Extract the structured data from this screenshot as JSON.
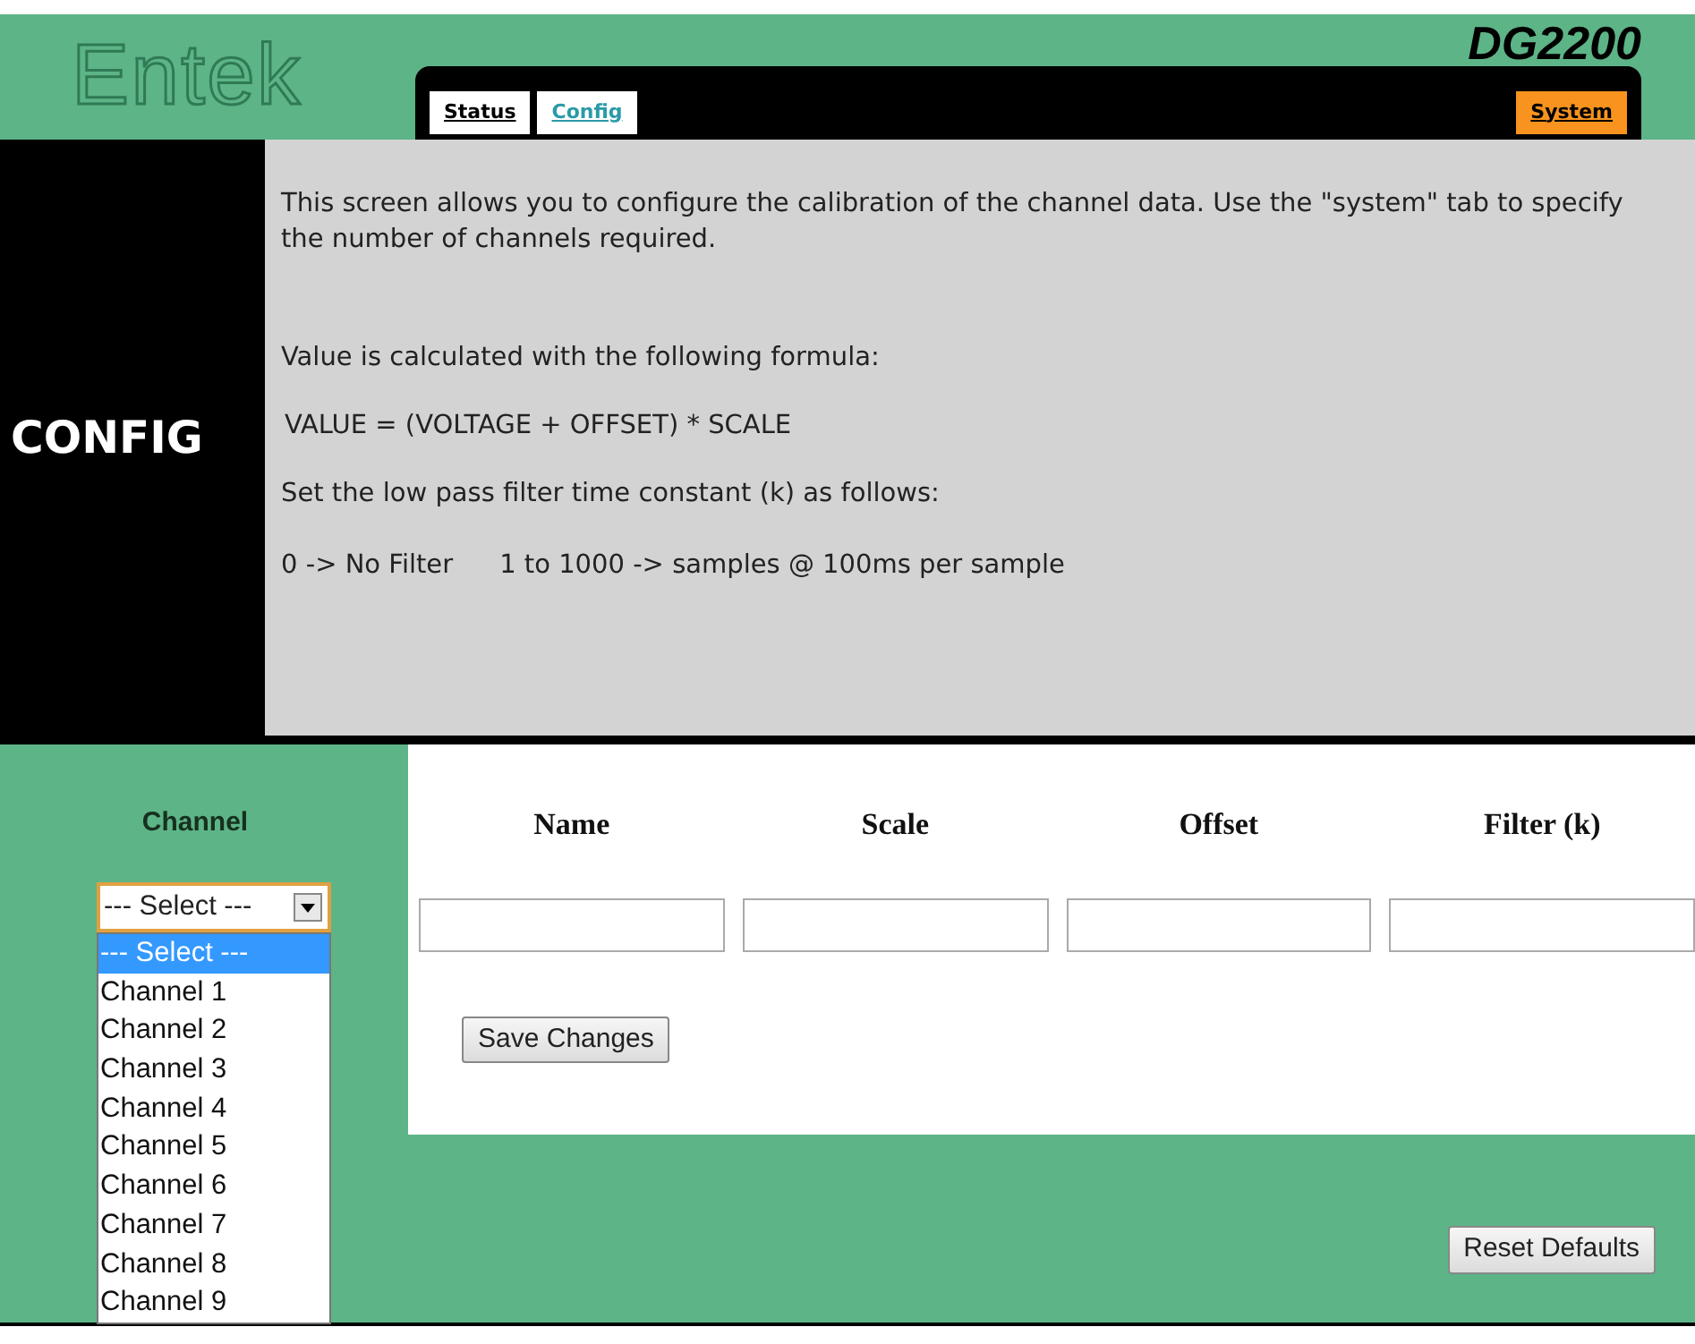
{
  "header": {
    "logo": "Entek",
    "model": "DG2200"
  },
  "tabs": [
    {
      "label": "Status",
      "selected": false,
      "kind": "left"
    },
    {
      "label": "Config",
      "selected": true,
      "kind": "left"
    },
    {
      "label": "System",
      "selected": false,
      "kind": "system"
    }
  ],
  "intro": {
    "heading": "CONFIG",
    "paragraphs": [
      "This screen allows you to configure the calibration of the channel data. Use the \"system\" tab to specify the number of channels required.",
      "Value is calculated with the following formula:",
      "VALUE = (VOLTAGE + OFFSET) * SCALE",
      "Set the low pass filter time constant (k) as follows:"
    ],
    "filter_notes": [
      "0 -> No Filter",
      "1 to 1000 -> samples @ 100ms per sample"
    ]
  },
  "channel": {
    "label": "Channel",
    "value": "--- Select ---",
    "expanded": true,
    "options": [
      {
        "label": "--- Select ---",
        "selected": true
      },
      {
        "label": "Channel 1",
        "selected": false
      },
      {
        "label": "Channel 2",
        "selected": false
      },
      {
        "label": "Channel 3",
        "selected": false
      },
      {
        "label": "Channel 4",
        "selected": false
      },
      {
        "label": "Channel 5",
        "selected": false
      },
      {
        "label": "Channel 6",
        "selected": false
      },
      {
        "label": "Channel 7",
        "selected": false
      },
      {
        "label": "Channel 8",
        "selected": false
      },
      {
        "label": "Channel 9",
        "selected": false
      }
    ]
  },
  "columns": [
    "Name",
    "Scale",
    "Offset",
    "Filter (k)"
  ],
  "buttons": {
    "save": "Save Changes",
    "reset": "Reset Defaults"
  }
}
